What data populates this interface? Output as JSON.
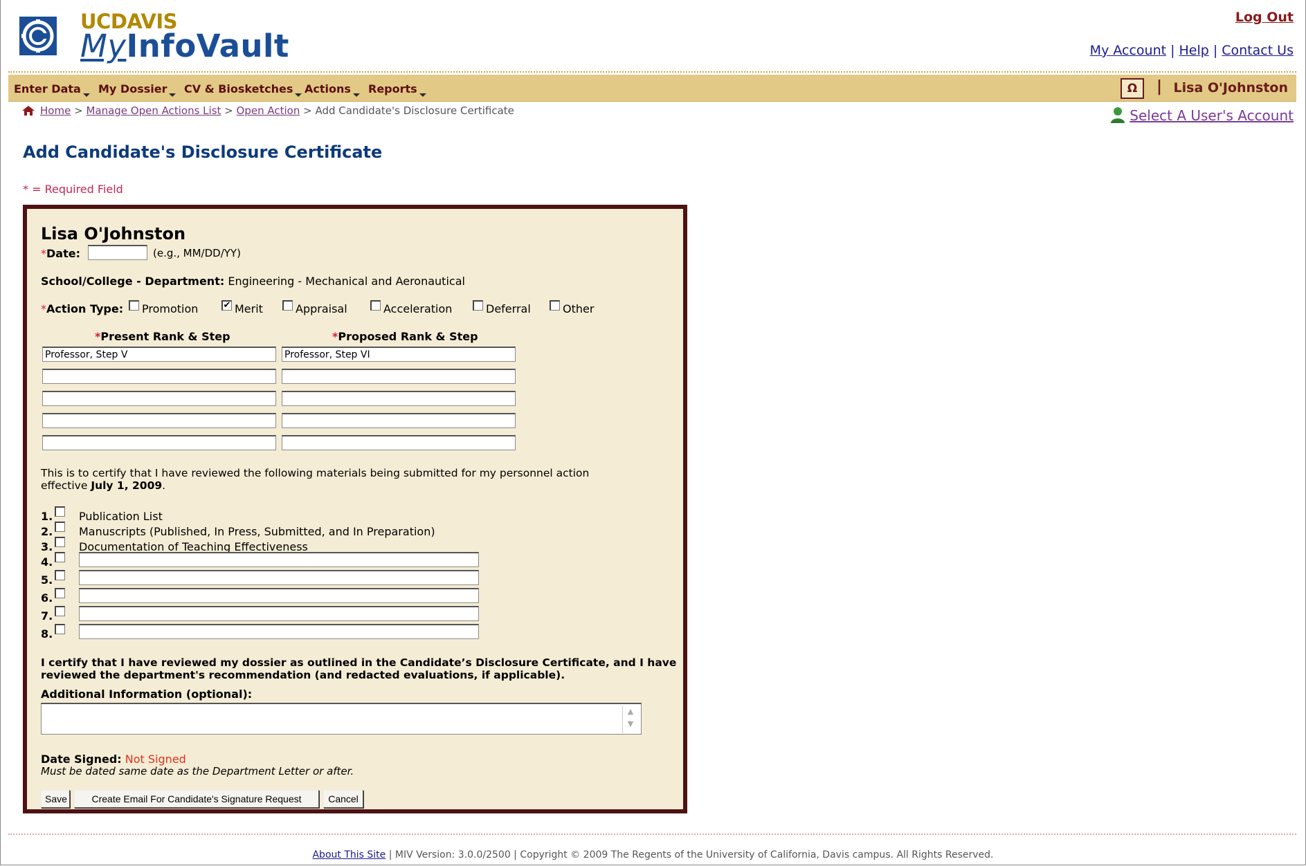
{
  "header": {
    "brand_uc": "UC",
    "brand_davis": "DAVIS",
    "app_my": "My",
    "app_name": "InfoVault",
    "logout": "Log Out",
    "links": [
      "My Account",
      "Help",
      "Contact Us"
    ],
    "link_sep": "|"
  },
  "nav": {
    "items": [
      "Enter Data",
      "My Dossier",
      "CV & Biosketches",
      "Actions",
      "Reports"
    ],
    "omega": "Ω",
    "sep": "|",
    "user": "Lisa O'Johnston"
  },
  "breadcrumb": {
    "home": "Home",
    "manage": "Manage Open Actions List",
    "open": "Open Action",
    "current": "Add Candidate's Disclosure Certificate",
    "sep": ">"
  },
  "select_account": "Select A User's Account",
  "page_title": "Add Candidate's Disclosure Certificate",
  "required_note": "* = Required Field",
  "form": {
    "candidate_name": "Lisa O'Johnston",
    "required_marker": "*",
    "date_label": "Date:",
    "date_value": "",
    "date_hint": "(e.g., MM/DD/YY)",
    "school_label": "School/College - Department:",
    "school_value": "Engineering - Mechanical and Aeronautical",
    "action_type_label": "Action Type:",
    "action_types": [
      {
        "label": "Promotion",
        "checked": false
      },
      {
        "label": "Merit",
        "checked": true
      },
      {
        "label": "Appraisal",
        "checked": false
      },
      {
        "label": "Acceleration",
        "checked": false
      },
      {
        "label": "Deferral",
        "checked": false
      },
      {
        "label": "Other",
        "checked": false
      }
    ],
    "present_header": "Present Rank & Step",
    "proposed_header": "Proposed Rank & Step",
    "rank_rows": [
      {
        "present": "Professor, Step V",
        "proposed": "Professor, Step VI"
      },
      {
        "present": "",
        "proposed": ""
      },
      {
        "present": "",
        "proposed": ""
      },
      {
        "present": "",
        "proposed": ""
      },
      {
        "present": "",
        "proposed": ""
      }
    ],
    "certify_text": "This is to certify that I have reviewed the following materials being submitted for my personnel action",
    "certify_effective": "effective",
    "certify_date": "July 1, 2009",
    "materials": [
      {
        "num": "1.",
        "label": "Publication List",
        "checked": false
      },
      {
        "num": "2.",
        "label": "Manuscripts (Published, In Press, Submitted, and In Preparation)",
        "checked": false
      },
      {
        "num": "3.",
        "label": "Documentation of Teaching Effectiveness",
        "checked": false
      },
      {
        "num": "4.",
        "value": "",
        "checked": false
      },
      {
        "num": "5.",
        "value": "",
        "checked": false
      },
      {
        "num": "6.",
        "value": "",
        "checked": false
      },
      {
        "num": "7.",
        "value": "",
        "checked": false
      },
      {
        "num": "8.",
        "value": "",
        "checked": false
      }
    ],
    "certify_bold_1": "I certify that I have reviewed my dossier as outlined in the Candidate’s Disclosure Certificate, and I have",
    "certify_bold_2": "reviewed the department's recommendation (and redacted evaluations, if applicable).",
    "additional_label": "Additional Information (optional):",
    "additional_value": "",
    "date_signed_label": "Date Signed:",
    "date_signed_value": "Not Signed",
    "date_signed_note": "Must be dated same date as the Department Letter or after.",
    "buttons": {
      "save": "Save",
      "email": "Create Email For Candidate's Signature Request",
      "cancel": "Cancel"
    }
  },
  "footer": {
    "about": "About This Site",
    "text": " | MIV Version: 3.0.0/2500 | Copyright © 2009 The Regents of the University of California, Davis campus. All Rights Reserved."
  },
  "colors": {
    "nav_bg": "#e2c986",
    "form_border": "#4e1212",
    "form_bg": "#f4ecd4",
    "title": "#0d3a7a",
    "required": "#d61c3a"
  }
}
